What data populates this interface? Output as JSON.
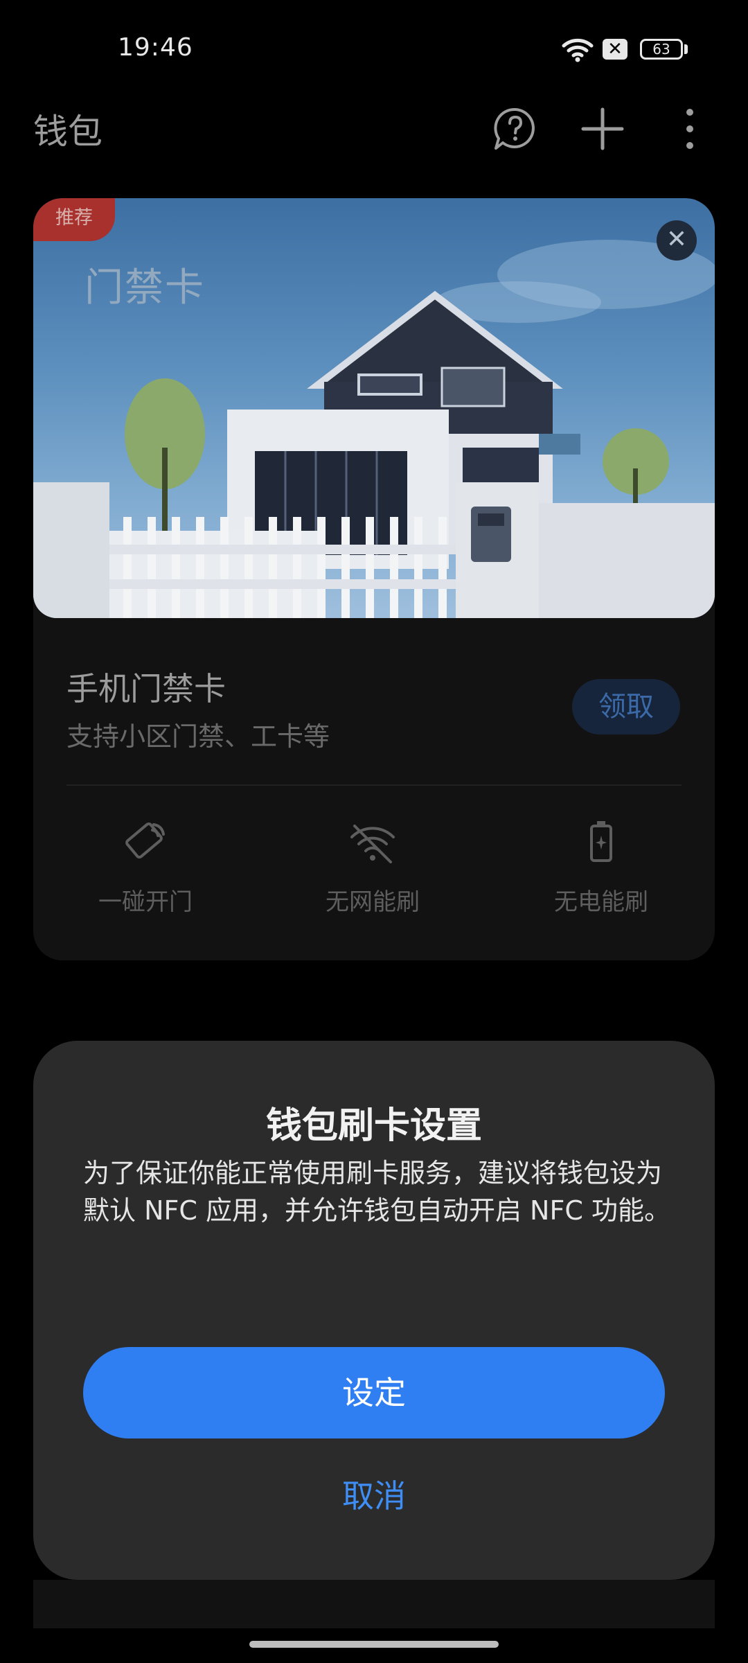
{
  "status_bar": {
    "time": "19:46",
    "battery": "63",
    "notification_glyph": "✕"
  },
  "header": {
    "title": "钱包",
    "icons": [
      "help-icon",
      "plus-icon",
      "more-vert-icon"
    ]
  },
  "card": {
    "badge": "推荐",
    "hero_title": "门禁卡",
    "close_glyph": "✕",
    "title": "手机门禁卡",
    "subtitle": "支持小区门禁、工卡等",
    "claim_label": "领取",
    "features": [
      {
        "label": "一碰开门",
        "icon": "nfc-tap-icon"
      },
      {
        "label": "无网能刷",
        "icon": "no-network-icon"
      },
      {
        "label": "无电能刷",
        "icon": "battery-empty-icon"
      }
    ]
  },
  "dialog": {
    "title": "钱包刷卡设置",
    "body": "为了保证你能正常使用刷卡服务，建议将钱包设为默认 NFC 应用，并允许钱包自动开启 NFC 功能。",
    "confirm_label": "设定",
    "cancel_label": "取消"
  },
  "colors": {
    "accent": "#2f7ef2",
    "dialog_bg": "#2b2b2b",
    "card_bg": "#121212",
    "badge": "#a8302d"
  }
}
